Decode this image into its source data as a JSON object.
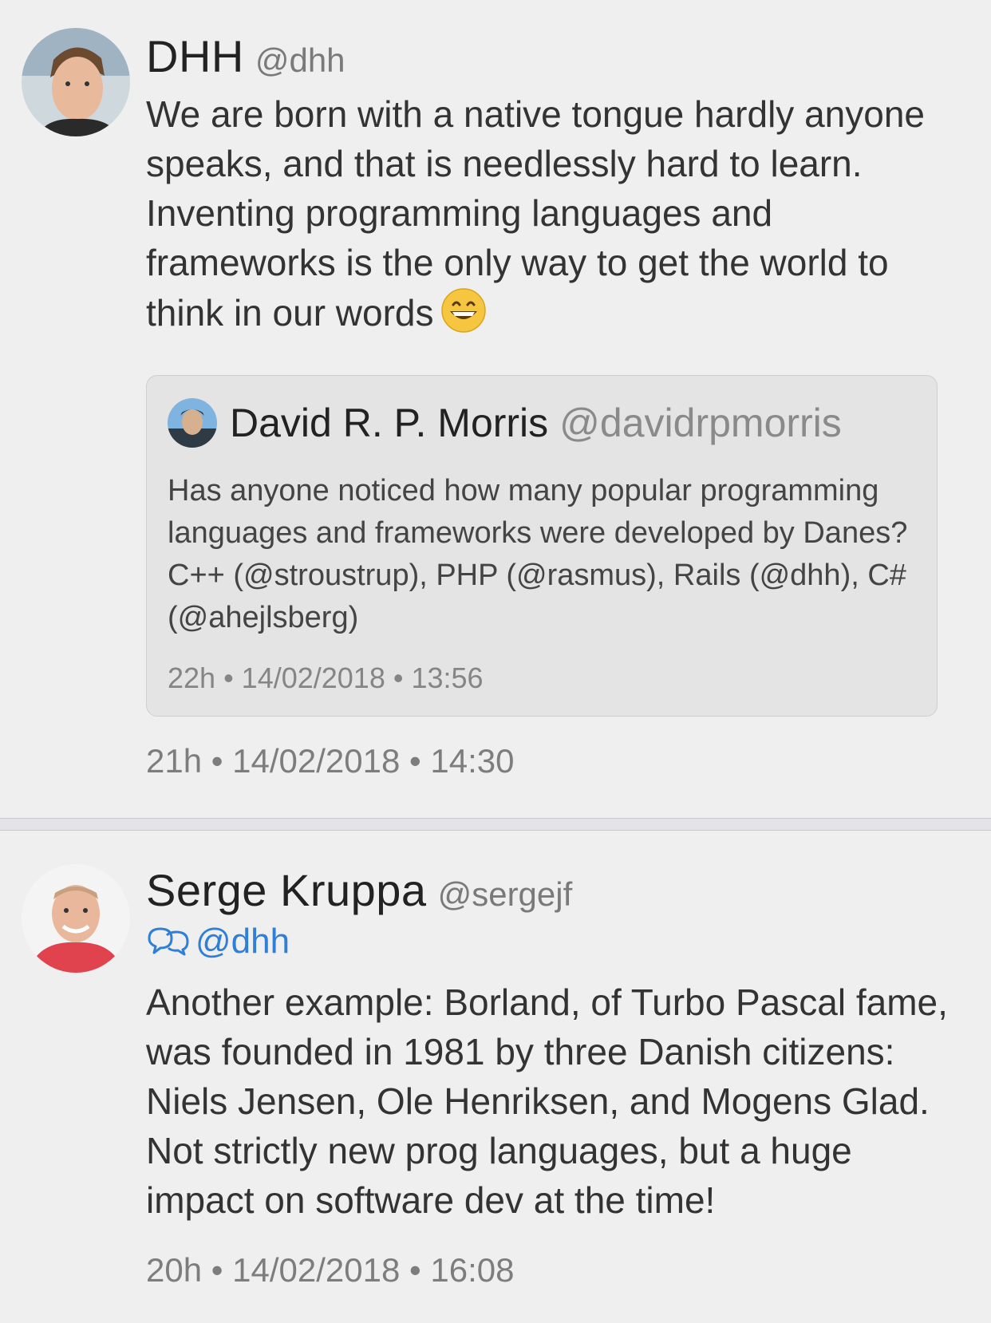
{
  "tweets": [
    {
      "name": "DHH",
      "handle": "@dhh",
      "text": "We are born with a native tongue hardly anyone speaks, and that is needlessly hard to learn. Inventing programming languages and frameworks is the only way to get the world to think in our words",
      "emoji": "grinning-face-emoji",
      "meta": "21h • 14/02/2018 • 14:30",
      "quoted": {
        "name": "David R. P. Morris",
        "handle": "@davidrpmorris",
        "text": "Has anyone noticed how many popular programming languages and frameworks  were developed by Danes? C++ (@stroustrup), PHP (@rasmus),  Rails (@dhh), C# (@ahejlsberg)",
        "meta": "22h • 14/02/2018 • 13:56"
      }
    },
    {
      "name": "Serge Kruppa",
      "handle": "@sergejf",
      "reply_to": "@dhh",
      "reply_icon": "speech-bubbles-icon",
      "text": "Another example: Borland, of Turbo Pascal fame, was founded in 1981 by three Danish citizens: Niels Jensen, Ole Henriksen, and Mogens Glad. Not strictly new prog languages, but a huge impact on software dev at the time!",
      "meta": "20h • 14/02/2018 • 16:08"
    }
  ],
  "colors": {
    "background": "#efefef",
    "link": "#2f7fd6",
    "muted": "#7d7d7d"
  }
}
